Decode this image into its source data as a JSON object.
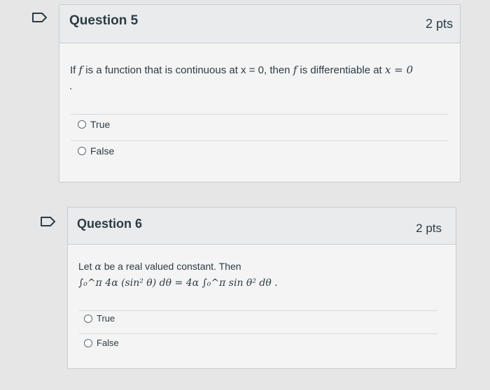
{
  "questions": [
    {
      "title": "Question 5",
      "points": "2 pts",
      "text_prefix": "If ",
      "text_f1": "f",
      "text_mid1": " is a function that is continuous at x = 0, then ",
      "text_f2": "f",
      "text_mid2": " is differentiable at ",
      "text_eq": "x = 0",
      "text_dot": ".",
      "options": [
        "True",
        "False"
      ]
    },
    {
      "title": "Question 6",
      "points": "2 pts",
      "line1_prefix": "Let ",
      "line1_alpha": "α",
      "line1_suffix": " be a real valued constant. Then",
      "line2_lhs": "∫₀^π 4α (sin² θ) dθ",
      "line2_eq": " = ",
      "line2_rhs": "4α ∫₀^π sin θ² dθ",
      "line2_dot": " .",
      "options": [
        "True",
        "False"
      ]
    }
  ]
}
